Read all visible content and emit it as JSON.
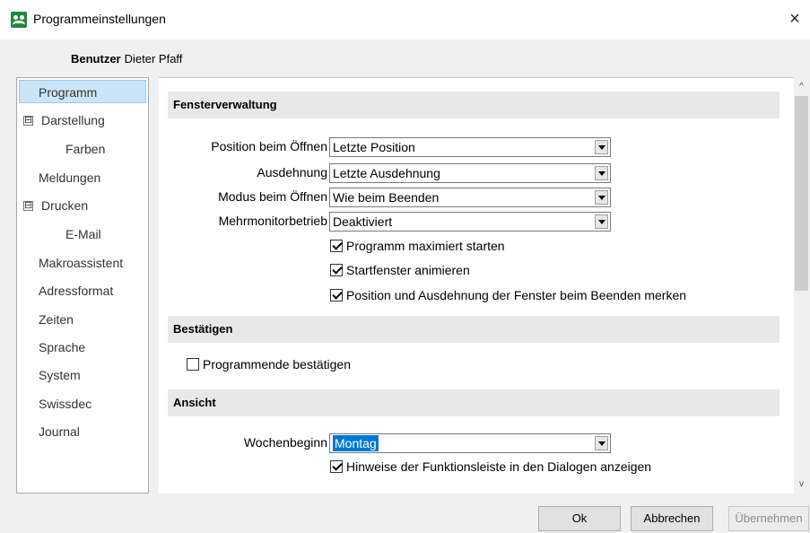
{
  "window": {
    "title": "Programmeinstellungen"
  },
  "user": {
    "label": "Benutzer",
    "name": "Dieter Pfaff"
  },
  "nav": {
    "items": [
      {
        "label": "Programm"
      },
      {
        "label": "Darstellung",
        "toggle": "⊟"
      },
      {
        "label": "Farben"
      },
      {
        "label": "Meldungen"
      },
      {
        "label": "Drucken",
        "toggle": "⊟"
      },
      {
        "label": "E-Mail"
      },
      {
        "label": "Makroassistent"
      },
      {
        "label": "Adressformat"
      },
      {
        "label": "Zeiten"
      },
      {
        "label": "Sprache"
      },
      {
        "label": "System"
      },
      {
        "label": "Swissdec"
      },
      {
        "label": "Journal"
      }
    ],
    "selected": "Programm"
  },
  "sections": {
    "fensterverwaltung": {
      "title": "Fensterverwaltung",
      "fields": [
        {
          "label": "Position beim Öffnen",
          "value": "Letzte Position"
        },
        {
          "label": "Ausdehnung",
          "value": "Letzte Ausdehnung"
        },
        {
          "label": "Modus beim Öffnen",
          "value": "Wie beim Beenden"
        },
        {
          "label": "Mehrmonitorbetrieb",
          "value": "Deaktiviert"
        }
      ],
      "checks": [
        {
          "label": "Programm maximiert starten",
          "checked": true
        },
        {
          "label": "Startfenster animieren",
          "checked": true
        },
        {
          "label": "Position und Ausdehnung der Fenster beim Beenden merken",
          "checked": true
        }
      ]
    },
    "bestaetigen": {
      "title": "Bestätigen",
      "checks": [
        {
          "label": "Programmende bestätigen",
          "checked": false
        }
      ]
    },
    "ansicht": {
      "title": "Ansicht",
      "fields": [
        {
          "label": "Wochenbeginn",
          "value": "Montag"
        }
      ],
      "checks": [
        {
          "label": "Hinweise der Funktionsleiste in den Dialogen anzeigen",
          "checked": true
        }
      ]
    }
  },
  "buttons": {
    "ok": "Ok",
    "cancel": "Abbrechen",
    "apply": "Übernehmen"
  },
  "icons": {
    "close": "×",
    "scroll_up": "^",
    "scroll_down": "v"
  }
}
